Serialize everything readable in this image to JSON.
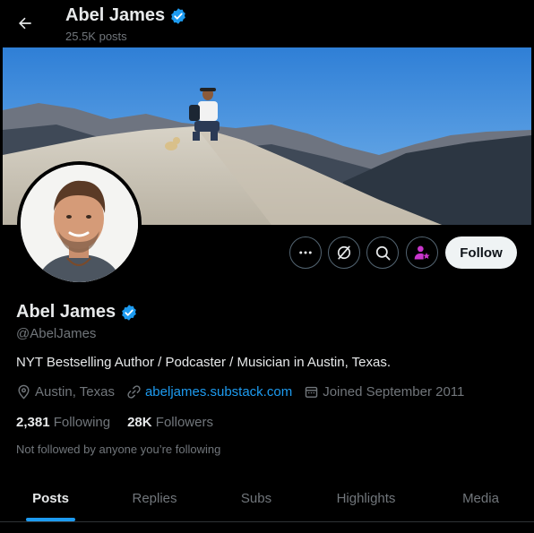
{
  "header": {
    "name": "Abel James",
    "posts_count": "25.5K posts",
    "back_icon": "arrow-left-icon"
  },
  "profile": {
    "name": "Abel James",
    "handle": "@AbelJames",
    "verified": true,
    "bio": "NYT Bestselling Author / Podcaster / Musician in Austin, Texas.",
    "location": "Austin, Texas",
    "website": "abeljames.substack.com",
    "joined": "Joined September 2011",
    "following_count": "2,381",
    "following_label": "Following",
    "followers_count": "28K",
    "followers_label": "Followers",
    "followed_by_text": "Not followed by anyone you’re following"
  },
  "actions": {
    "more_icon": "more-icon",
    "grok_icon": "grok-icon",
    "search_icon": "search-icon",
    "subscribe_icon": "subscribe-icon",
    "follow_label": "Follow"
  },
  "tabs": [
    {
      "label": "Posts",
      "active": true
    },
    {
      "label": "Replies",
      "active": false
    },
    {
      "label": "Subs",
      "active": false
    },
    {
      "label": "Highlights",
      "active": false
    },
    {
      "label": "Media",
      "active": false
    }
  ],
  "colors": {
    "background": "#000000",
    "accent": "#1d9bf0",
    "muted": "#71767b",
    "text": "#e7e9ea",
    "subscribe": "#c936cc"
  }
}
